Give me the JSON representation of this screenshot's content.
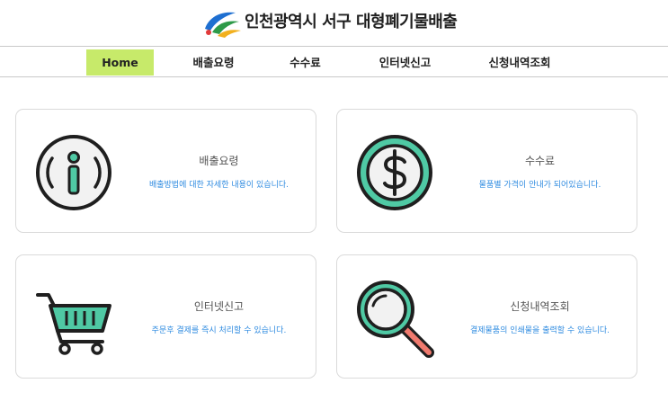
{
  "header": {
    "brand": "인천광역시 서구 대형폐기물배출"
  },
  "nav": [
    {
      "label": "Home",
      "active": true
    },
    {
      "label": "배출요령",
      "active": false
    },
    {
      "label": "수수료",
      "active": false
    },
    {
      "label": "인터넷신고",
      "active": false
    },
    {
      "label": "신청내역조회",
      "active": false
    }
  ],
  "cards": [
    {
      "icon": "info-icon",
      "title": "배출요령",
      "desc": "배출방법에 대한 자세한 내용이 있습니다."
    },
    {
      "icon": "dollar-coin-icon",
      "title": "수수료",
      "desc": "물품별 가격이 안내가 되어있습니다."
    },
    {
      "icon": "shopping-cart-icon",
      "title": "인터넷신고",
      "desc": "주문후 결제를 즉시 처리할 수 있습니다."
    },
    {
      "icon": "magnifier-icon",
      "title": "신청내역조회",
      "desc": "결제물품의 인쇄물을 출력할 수 있습니다."
    }
  ],
  "colors": {
    "active_nav": "#c7ea6a",
    "accent_teal": "#4fc9a4",
    "desc_blue": "#2f8be0",
    "magnifier_handle": "#f07a6e"
  }
}
